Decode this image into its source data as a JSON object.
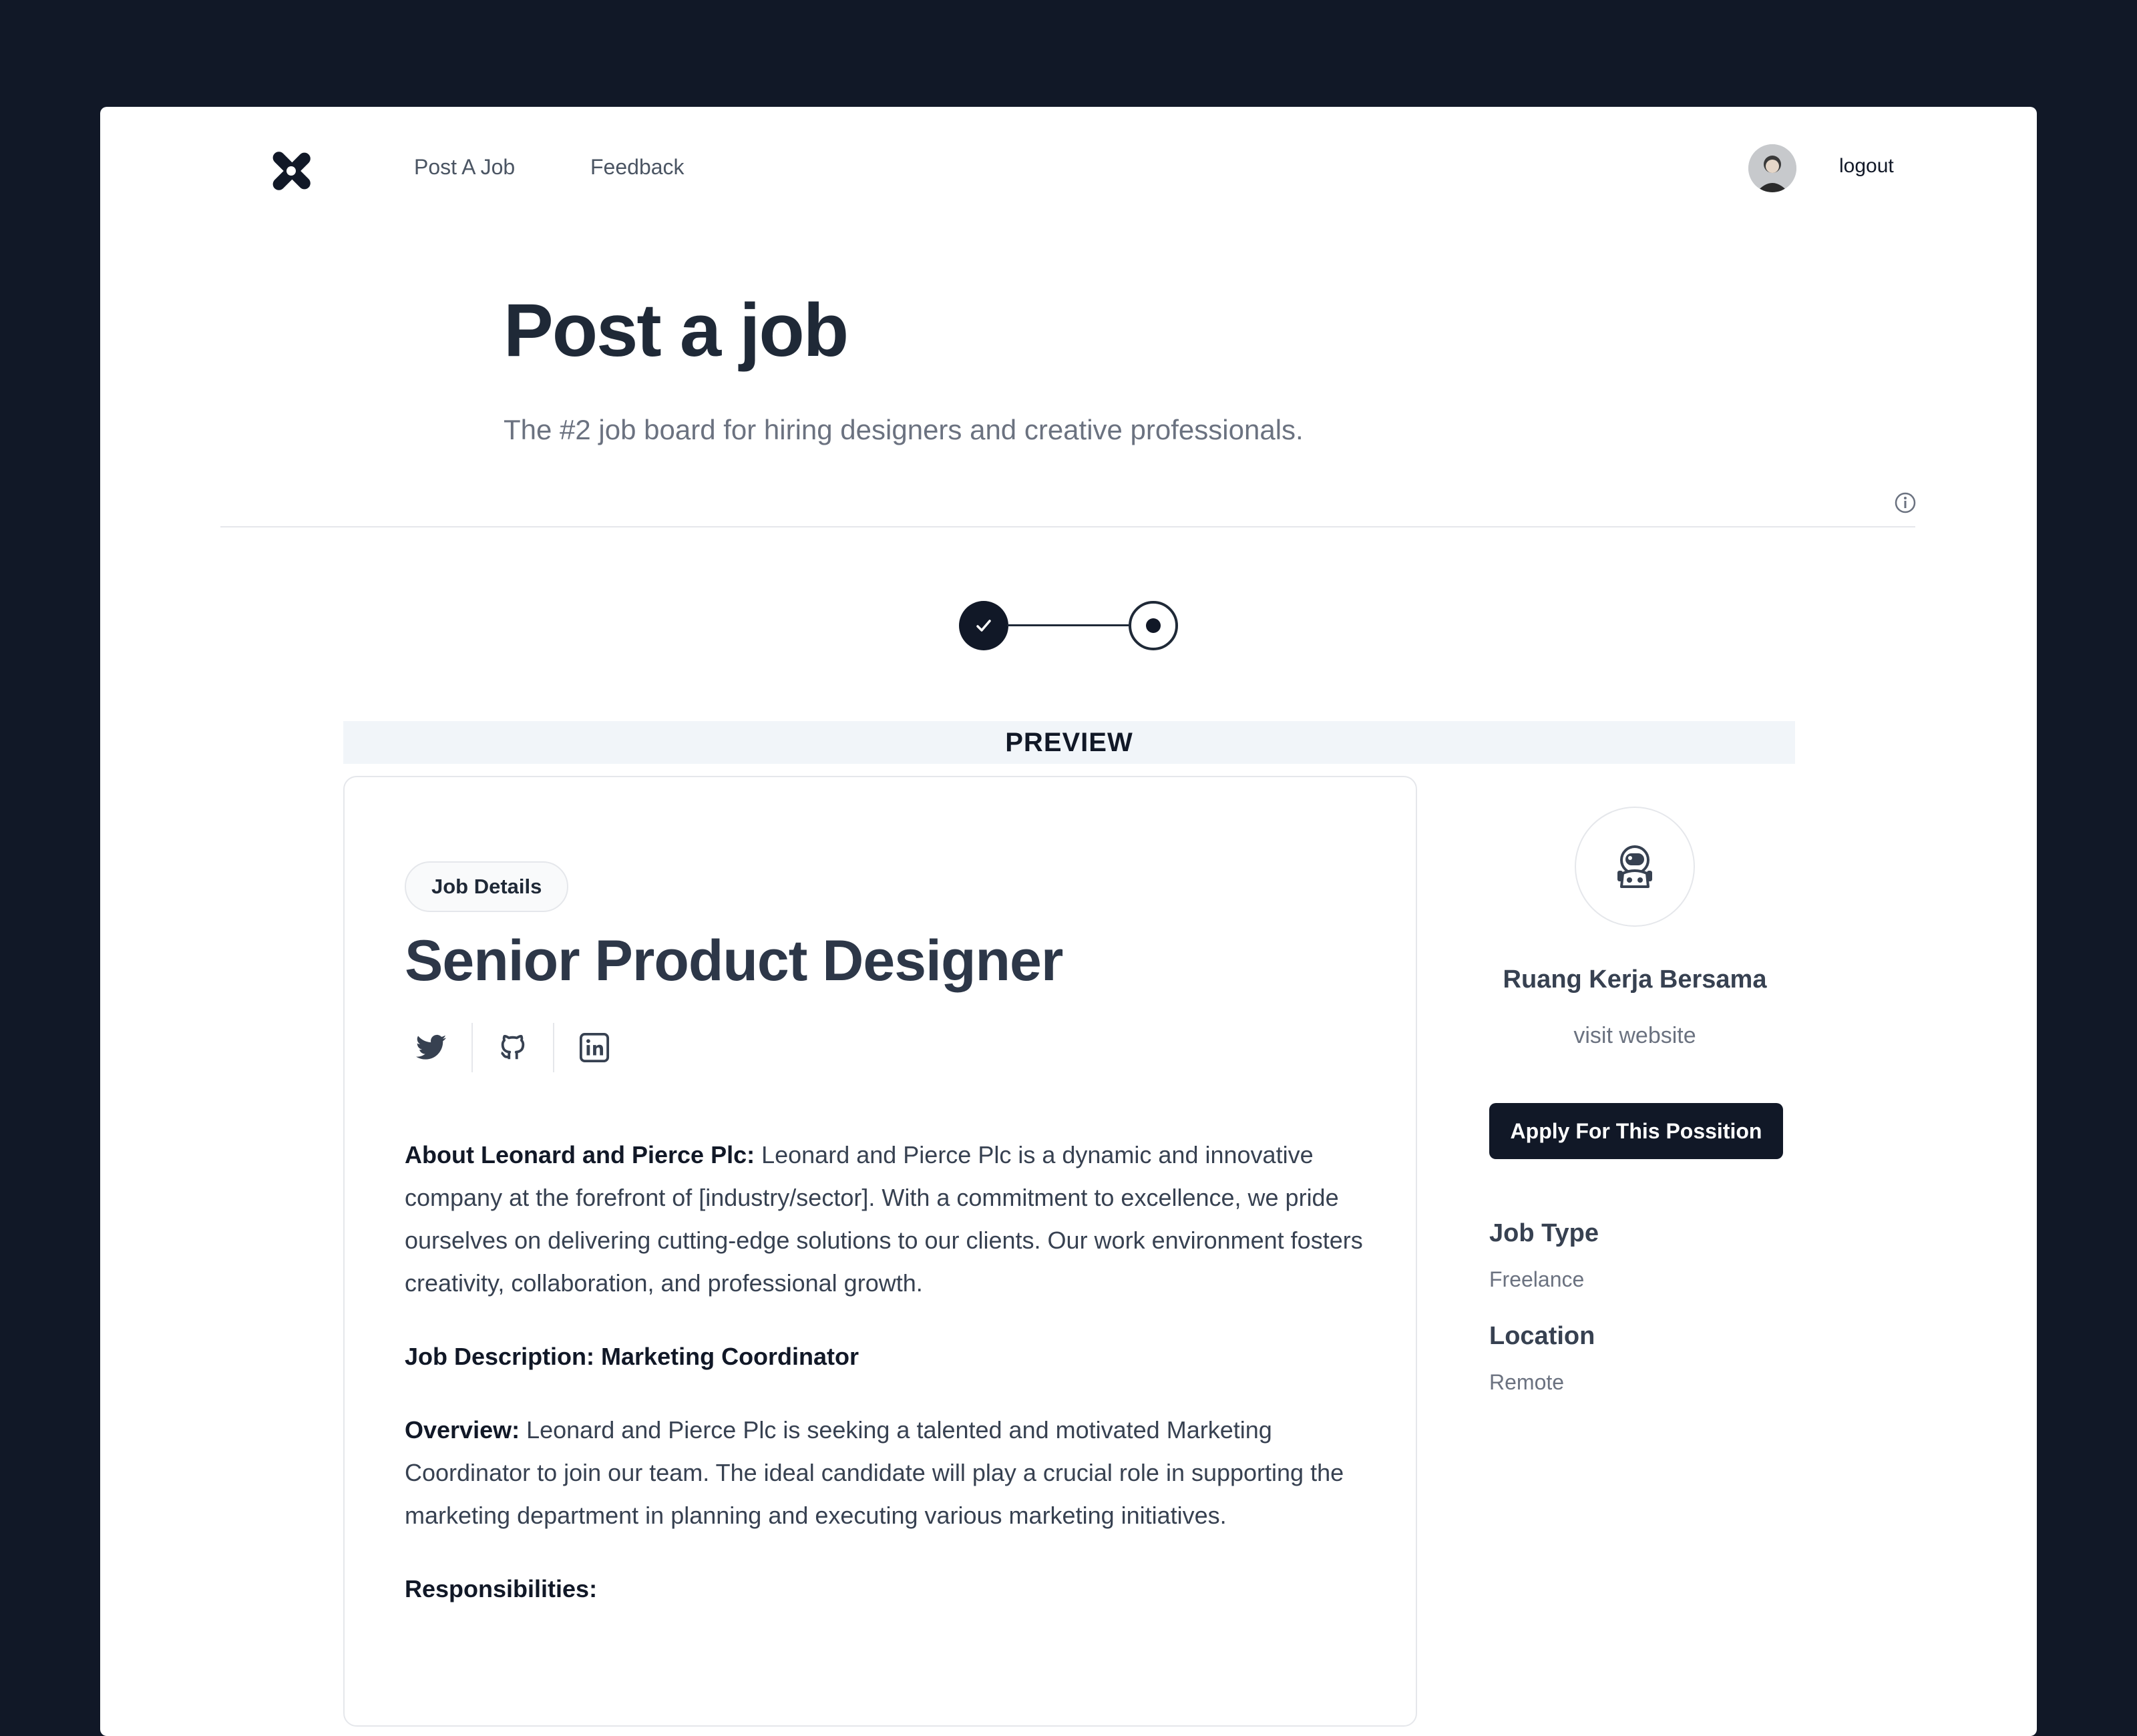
{
  "nav": {
    "logo_icon": "x-logo-icon",
    "links": [
      "Post A Job",
      "Feedback"
    ],
    "logout_label": "logout"
  },
  "hero": {
    "title": "Post a job",
    "subtitle": "The #2 job board for hiring designers and creative professionals."
  },
  "stepper": {
    "steps": [
      {
        "state": "completed",
        "icon": "check-icon"
      },
      {
        "state": "current",
        "icon": "dot-icon"
      }
    ]
  },
  "preview": {
    "label": "PREVIEW"
  },
  "job": {
    "badge": "Job Details",
    "title": "Senior Product Designer",
    "socials": [
      "twitter-icon",
      "github-icon",
      "linkedin-icon"
    ],
    "about_label": "About Leonard and Pierce Plc:",
    "about_text": " Leonard and Pierce Plc is a dynamic and innovative company at the forefront of [industry/sector]. With a commitment to excellence, we pride ourselves on delivering cutting-edge solutions to our clients. Our work environment fosters creativity, collaboration, and professional growth.",
    "description_heading": "Job Description: Marketing Coordinator",
    "overview_label": "Overview:",
    "overview_text": " Leonard and Pierce Plc is seeking a talented and motivated Marketing Coordinator to join our team. The ideal candidate will play a crucial role in supporting the marketing department in planning and executing various marketing initiatives.",
    "responsibilities_heading": "Responsibilities:"
  },
  "company": {
    "name": "Ruang Kerja Bersama",
    "website_label": "visit website",
    "apply_label": "Apply For This Possition",
    "job_type_label": "Job Type",
    "job_type_value": "Freelance",
    "location_label": "Location",
    "location_value": "Remote"
  },
  "colors": {
    "page_bg": "#111827",
    "primary": "#111827",
    "preview_bg": "#f1f5f9"
  }
}
